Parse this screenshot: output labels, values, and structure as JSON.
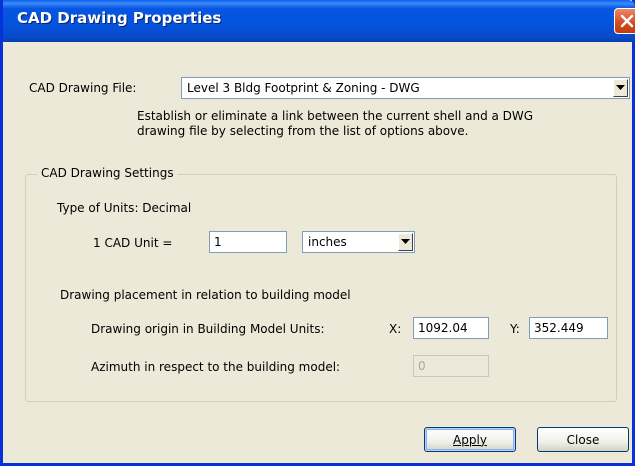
{
  "window": {
    "title": "CAD Drawing Properties"
  },
  "cad_file": {
    "label": "CAD Drawing File:",
    "selected": "Level 3 Bldg Footprint & Zoning - DWG",
    "help_line1": "Establish or eliminate a link between the current shell and a DWG",
    "help_line2": "drawing file by selecting from the list of options above."
  },
  "settings": {
    "group_title": "CAD Drawing Settings",
    "units_type": "Type of Units: Decimal",
    "cad_unit_label": "1 CAD Unit =",
    "cad_unit_value": "1",
    "unit_selected": "inches",
    "placement_heading": "Drawing placement in relation to building model",
    "origin_label": "Drawing origin in Building Model Units:",
    "x_label": "X:",
    "x_value": "1092.04",
    "y_label": "Y:",
    "y_value": "352.449",
    "azimuth_label": "Azimuth in respect to the building model:",
    "azimuth_value": "0"
  },
  "buttons": {
    "apply": "Apply",
    "close": "Close"
  },
  "icons": {
    "close": "close-x-icon",
    "dropdown": "chevron-down-icon"
  },
  "colors": {
    "titlebar": "#0453dc",
    "close_button": "#d94d22",
    "dialog_bg": "#ece9d8"
  }
}
